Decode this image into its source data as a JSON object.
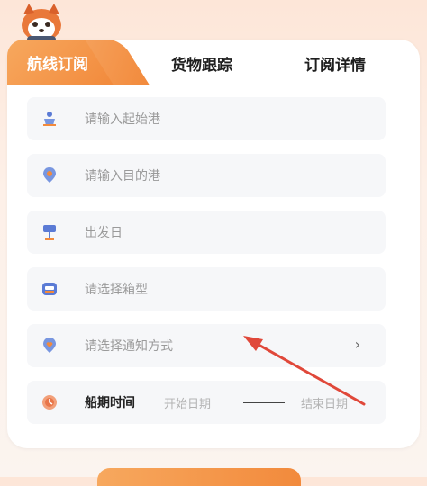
{
  "tabs": [
    {
      "label": "航线订阅",
      "active": true
    },
    {
      "label": "货物跟踪",
      "active": false
    },
    {
      "label": "订阅详情",
      "active": false
    }
  ],
  "form": {
    "origin_placeholder": "请输入起始港",
    "destination_placeholder": "请输入目的港",
    "departure_placeholder": "出发日",
    "container_placeholder": "请选择箱型",
    "notify_placeholder": "请选择通知方式",
    "schedule_label": "船期时间",
    "start_date_placeholder": "开始日期",
    "end_date_placeholder": "结束日期",
    "chevron": "›"
  },
  "colors": {
    "accent": "#f28a3c",
    "icon_blue": "#5b7bd5",
    "arrow_red": "#e0483a"
  },
  "icons": [
    "red-panda-mascot",
    "ship-icon",
    "location-pin-icon",
    "signpost-icon",
    "container-icon",
    "heart-pin-icon",
    "clock-icon",
    "chevron-right-icon"
  ]
}
